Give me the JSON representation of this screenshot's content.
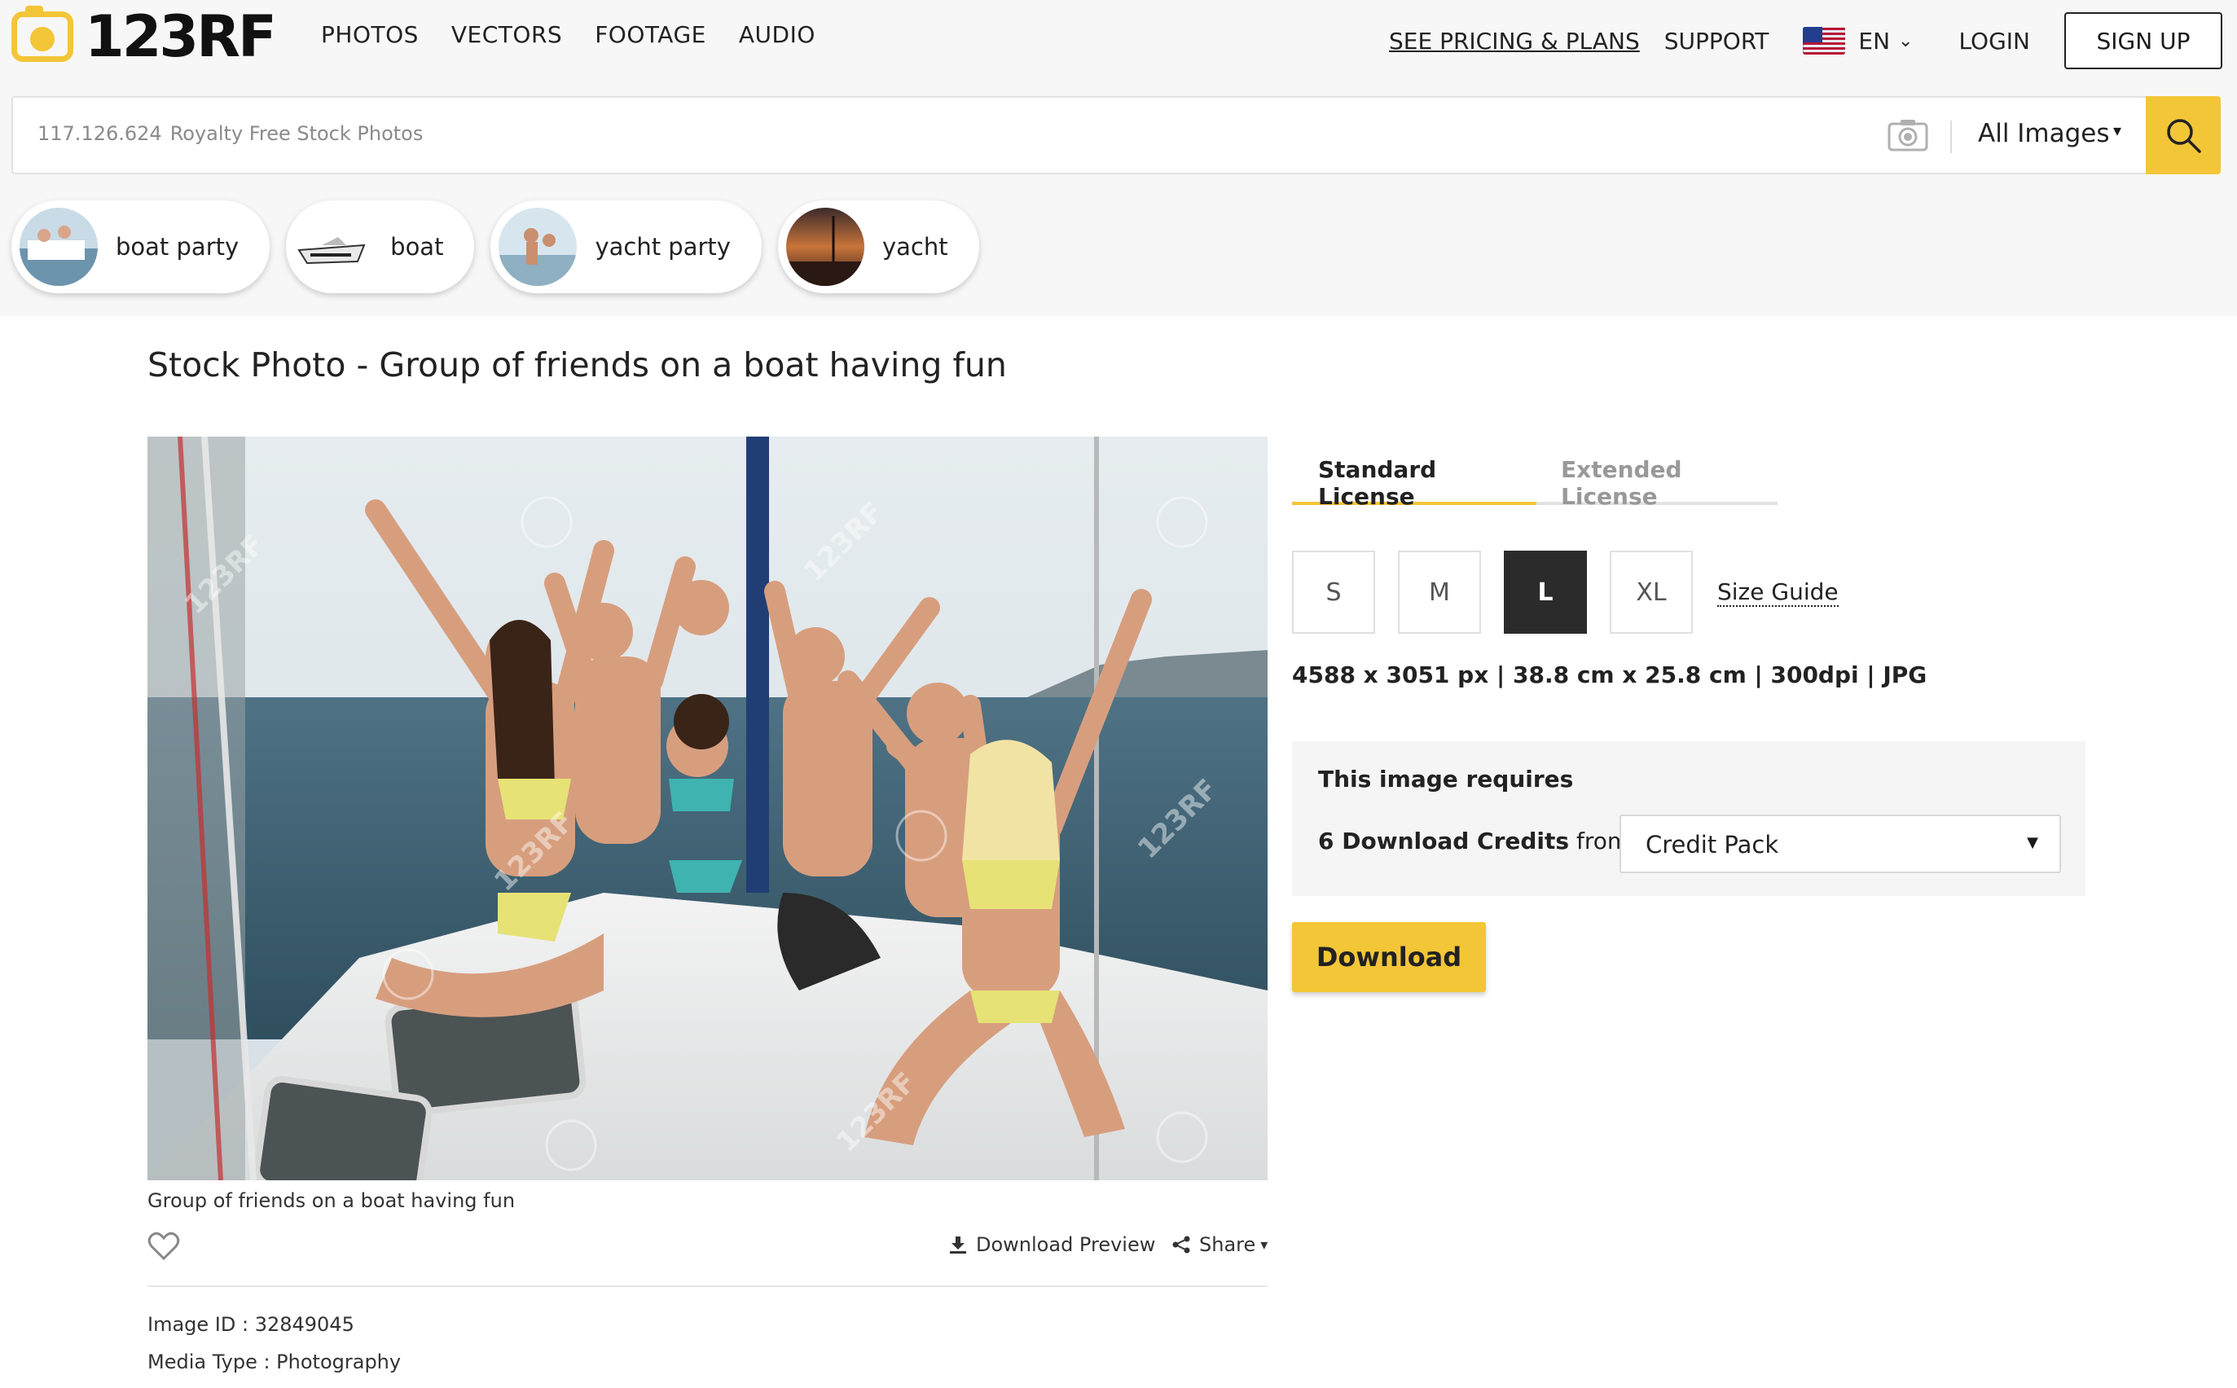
{
  "brand": {
    "logo_text": "123RF",
    "accent": "#f3c637"
  },
  "nav": {
    "links": [
      "PHOTOS",
      "VECTORS",
      "FOOTAGE",
      "AUDIO"
    ],
    "pricing": "SEE PRICING & PLANS",
    "support": "SUPPORT",
    "lang": "EN",
    "login": "LOGIN",
    "signup": "SIGN UP"
  },
  "search": {
    "count": "117.126.624",
    "placeholder": "Royalty Free Stock Photos",
    "filter": "All Images"
  },
  "chips": [
    {
      "label": "boat party"
    },
    {
      "label": "boat"
    },
    {
      "label": "yacht party"
    },
    {
      "label": "yacht"
    }
  ],
  "main": {
    "title": "Stock Photo - Group of friends on a boat having fun",
    "caption": "Group of friends on a boat having fun",
    "download_preview": "Download Preview",
    "share": "Share",
    "image_id": "Image ID : 32849045",
    "media_type": "Media Type : Photography",
    "watermark": "123RF"
  },
  "license": {
    "tabs": [
      "Standard License",
      "Extended License"
    ],
    "active_tab": "Standard License",
    "sizes": [
      "S",
      "M",
      "L",
      "XL"
    ],
    "selected_size": "L",
    "size_guide": "Size Guide",
    "dims": "4588 x 3051 px | 38.8 cm x 25.8 cm | 300dpi | JPG",
    "requires": "This image requires",
    "credits": "6 Download Credits",
    "from": "from",
    "plan": "Credit Pack",
    "download": "Download"
  }
}
